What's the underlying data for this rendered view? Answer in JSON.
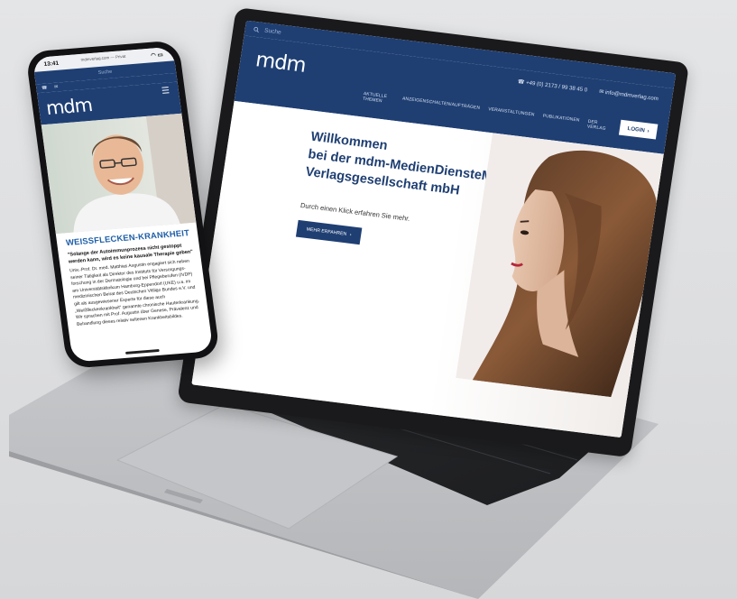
{
  "colors": {
    "brand_navy": "#1f3f73",
    "brand_blue": "#1f5fa8",
    "white": "#ffffff"
  },
  "laptop_site": {
    "search_label": "Suche",
    "logo": "mdm",
    "phone": "+49 (0) 2173 / 99 38 45 0",
    "email": "info@mdmverlag.com",
    "nav": [
      "AKTUELLE THEMEN",
      "ANZEIGENSCHALTEN/AUFTRÄGEN",
      "VERANSTALTUNGEN",
      "PUBLIKATIONEN",
      "DER VERLAG"
    ],
    "login_label": "LOGIN",
    "hero_title_lines": [
      "Willkommen",
      "bei der mdm-MedienDiensteMedizin-",
      "Verlagsgesellschaft mbH"
    ],
    "hero_subtitle": "Durch einen Klick erfahren Sie mehr.",
    "hero_button": "MEHR ERFAHREN"
  },
  "phone_site": {
    "status_time": "13:41",
    "url": "mdmverlag.com — Privat",
    "search_label": "Suche",
    "logo": "mdm",
    "article_title": "WEISSFLECKEN-KRANKHEIT",
    "article_lead": "\"Solange der Autoimmunprozess nicht gestoppt werden kann, wird es keine kausale Therapie geben\"",
    "article_body": "Univ.-Prof. Dr. med. Matthias Augustin engagiert sich neben seiner Tätigkeit als Direktor des Instituts für Versorgungs- forschung in der Dermatologie und bei Pflegeberufen (IVDP) am Universitätsklinikum Hamburg-Eppendorf (UKE) u.a. im medizinischen Beirat des Deutschen Vitiligo Bundes e.V. und gilt als ausgewiesener Experte für diese auch „Weißfleckenkrankheit\" genannte chronische Hauterkrankung. Wir sprachen mit Prof. Augustin über Genese, Prävalenz und Behandlung dieses relativ seltenen Krankheitsbildes."
  },
  "icons": [
    "search-icon",
    "phone-icon",
    "mail-icon",
    "chevron-right-icon",
    "hamburger-menu-icon",
    "wifi-icon",
    "battery-icon"
  ]
}
